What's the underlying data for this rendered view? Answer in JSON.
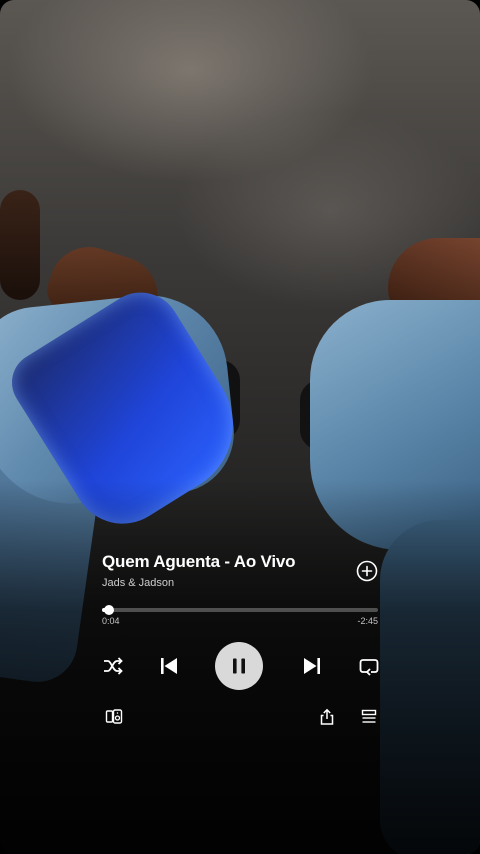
{
  "track": {
    "title": "Quem Aguenta - Ao Vivo",
    "artist": "Jads & Jadson"
  },
  "progress": {
    "elapsed": "0:04",
    "remaining": "-2:45",
    "fraction": 0.024
  },
  "state": {
    "playing": true
  },
  "icons": {
    "add": "plus-circle-icon",
    "shuffle": "shuffle-icon",
    "previous": "skip-previous-icon",
    "pause": "pause-icon",
    "next": "skip-next-icon",
    "repeat": "repeat-icon",
    "devices": "connect-devices-icon",
    "share": "share-icon",
    "queue": "queue-icon"
  },
  "colors": {
    "text": "#ffffff",
    "play_button_bg": "#ebebeb",
    "denim": "#5f89ad",
    "cup_blue": "#1f44d8"
  }
}
